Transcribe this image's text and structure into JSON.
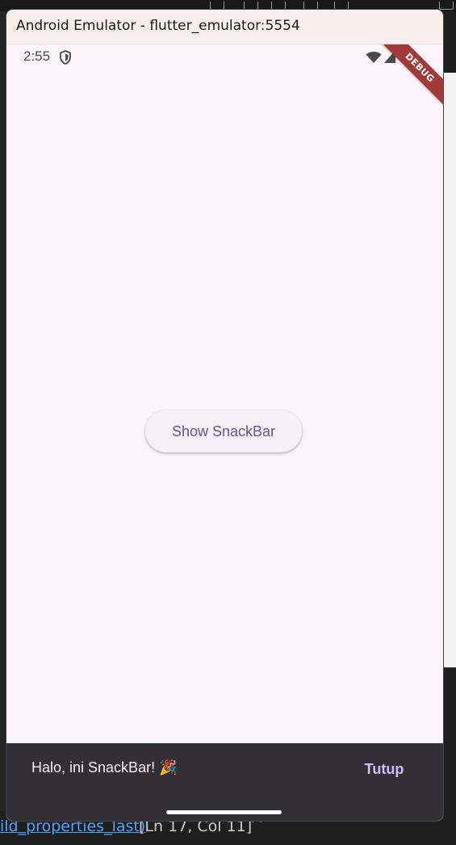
{
  "emulator": {
    "window_title": "Android Emulator - flutter_emulator:5554"
  },
  "status_bar": {
    "time": "2:55",
    "icons": [
      "shield-icon",
      "wifi-icon",
      "signal-icon",
      "battery-icon"
    ]
  },
  "debug_banner": {
    "label": "DEBUG"
  },
  "main": {
    "show_snackbar_label": "Show SnackBar"
  },
  "snackbar": {
    "message": "Halo, ini SnackBar! 🎉",
    "action_label": "Tutup"
  },
  "background_editor": {
    "status_link": "ild_properties_last)",
    "cursor_position": "[Ln 17, Col 11]"
  },
  "colors": {
    "screen_background": "#fdf5fc",
    "button_text": "#6a4fa3",
    "snackbar_background": "#322f35",
    "snackbar_action": "#d0bcff",
    "debug_banner": "#a33a3a"
  }
}
